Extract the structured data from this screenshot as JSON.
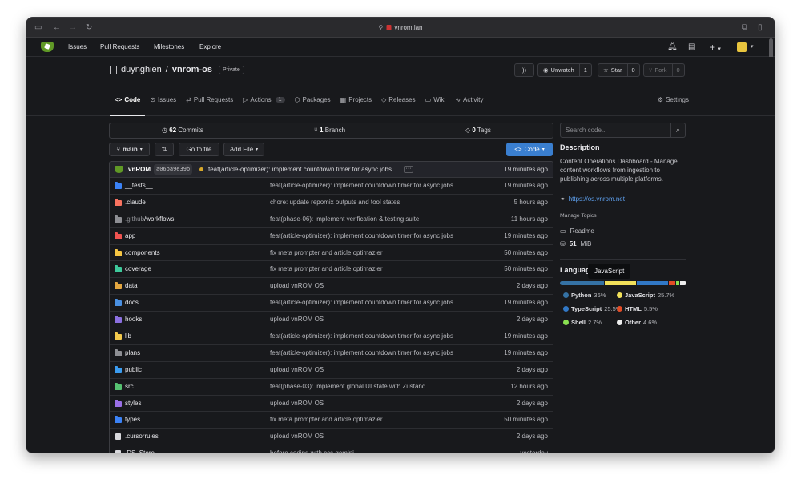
{
  "browser": {
    "url": "vnrom.lan",
    "icons": [
      "sidebar-icon",
      "back-icon",
      "forward-icon",
      "reload-icon",
      "lock-icon",
      "share-icon",
      "tabs-icon"
    ]
  },
  "nav": {
    "items": [
      "Issues",
      "Pull Requests",
      "Milestones",
      "Explore"
    ],
    "add": "+",
    "caret": "▾"
  },
  "repo": {
    "owner": "duynghien",
    "separator": "/",
    "name": "vnrom-os",
    "visibility": "Private",
    "watch_label": "Unwatch",
    "watch_count": "1",
    "star_label": "Star",
    "star_count": "0",
    "fork_label": "Fork",
    "fork_count": "0",
    "tabs": [
      {
        "label": "Code",
        "icon": "<>"
      },
      {
        "label": "Issues"
      },
      {
        "label": "Pull Requests"
      },
      {
        "label": "Actions",
        "count": "1"
      },
      {
        "label": "Packages"
      },
      {
        "label": "Projects"
      },
      {
        "label": "Releases"
      },
      {
        "label": "Wiki"
      },
      {
        "label": "Activity"
      }
    ],
    "settings_label": "Settings"
  },
  "stats": {
    "commits_num": "62",
    "commits_label": "Commits",
    "branches_num": "1",
    "branches_label": "Branch",
    "tags_num": "0",
    "tags_label": "Tags"
  },
  "toolbar": {
    "branch": "main",
    "go_to_file": "Go to file",
    "add_file": "Add File",
    "code": "Code",
    "caret": "▾"
  },
  "latest_commit": {
    "author": "vnROM",
    "sha": "a06ba9e39b",
    "message": "feat(article-optimizer): implement countdown timer for async jobs",
    "more": "···",
    "time": "19 minutes ago"
  },
  "files": [
    {
      "name": "__tests__",
      "type": "dir",
      "color": "#3b82f6",
      "message": "feat(article-optimizer): implement countdown timer for async jobs",
      "time": "19 minutes ago"
    },
    {
      "name": ".claude",
      "type": "dir",
      "color": "#f97360",
      "message": "chore: update repomix outputs and tool states",
      "time": "5 hours ago"
    },
    {
      "name": ".github",
      "suffix": "/workflows",
      "type": "dir",
      "color": "#8e8f94",
      "message": "feat(phase-06): implement verification & testing suite",
      "time": "11 hours ago"
    },
    {
      "name": "app",
      "type": "dir",
      "color": "#ef5350",
      "message": "feat(article-optimizer): implement countdown timer for async jobs",
      "time": "19 minutes ago"
    },
    {
      "name": "components",
      "type": "dir",
      "color": "#f5c543",
      "message": "fix meta prompter and article optimazier",
      "time": "50 minutes ago"
    },
    {
      "name": "coverage",
      "type": "dir",
      "color": "#3ec99b",
      "message": "fix meta prompter and article optimazier",
      "time": "50 minutes ago"
    },
    {
      "name": "data",
      "type": "dir",
      "color": "#e3a640",
      "message": "upload vnROM OS",
      "time": "2 days ago"
    },
    {
      "name": "docs",
      "type": "dir",
      "color": "#4a90e2",
      "message": "feat(article-optimizer): implement countdown timer for async jobs",
      "time": "19 minutes ago"
    },
    {
      "name": "hooks",
      "type": "dir",
      "color": "#8b6fe0",
      "message": "upload vnROM OS",
      "time": "2 days ago"
    },
    {
      "name": "lib",
      "type": "dir",
      "color": "#f2c94c",
      "message": "feat(article-optimizer): implement countdown timer for async jobs",
      "time": "19 minutes ago"
    },
    {
      "name": "plans",
      "type": "dir",
      "color": "#8e8f94",
      "message": "feat(article-optimizer): implement countdown timer for async jobs",
      "time": "19 minutes ago"
    },
    {
      "name": "public",
      "type": "dir",
      "color": "#3b9cf0",
      "message": "upload vnROM OS",
      "time": "2 days ago"
    },
    {
      "name": "src",
      "type": "dir",
      "color": "#56c271",
      "message": "feat(phase-03): implement global UI state with Zustand",
      "time": "12 hours ago"
    },
    {
      "name": "styles",
      "type": "dir",
      "color": "#9a6fe6",
      "message": "upload vnROM OS",
      "time": "2 days ago"
    },
    {
      "name": "types",
      "type": "dir",
      "color": "#3b82f6",
      "message": "fix meta prompter and article optimazier",
      "time": "50 minutes ago"
    },
    {
      "name": ".cursorrules",
      "type": "file",
      "color": "#d8d8dc",
      "message": "upload vnROM OS",
      "time": "2 days ago"
    },
    {
      "name": ".DS_Store",
      "type": "file",
      "color": "#d8d8dc",
      "message": "before coding with ccs gemini",
      "time": "yesterday"
    }
  ],
  "sidebar": {
    "search_placeholder": "Search code...",
    "description_title": "Description",
    "description": "Content Operations Dashboard - Manage content workflows from ingestion to publishing across multiple platforms.",
    "website": "https://os.vnrom.net",
    "manage_topics": "Manage Topics",
    "readme": "Readme",
    "size_num": "51",
    "size_unit": "MiB",
    "languages_title": "Languages",
    "tooltip": "JavaScript",
    "languages": [
      {
        "name": "Python",
        "percent": "36%",
        "value": 36,
        "color": "#3572A5"
      },
      {
        "name": "JavaScript",
        "percent": "25.7%",
        "value": 25.7,
        "color": "#f1e05a"
      },
      {
        "name": "TypeScript",
        "percent": "25.5%",
        "value": 25.5,
        "color": "#3178c6"
      },
      {
        "name": "HTML",
        "percent": "5.5%",
        "value": 5.5,
        "color": "#e34c26"
      },
      {
        "name": "Shell",
        "percent": "2.7%",
        "value": 2.7,
        "color": "#89e051"
      },
      {
        "name": "Other",
        "percent": "4.6%",
        "value": 4.6,
        "color": "#ededed"
      }
    ]
  }
}
